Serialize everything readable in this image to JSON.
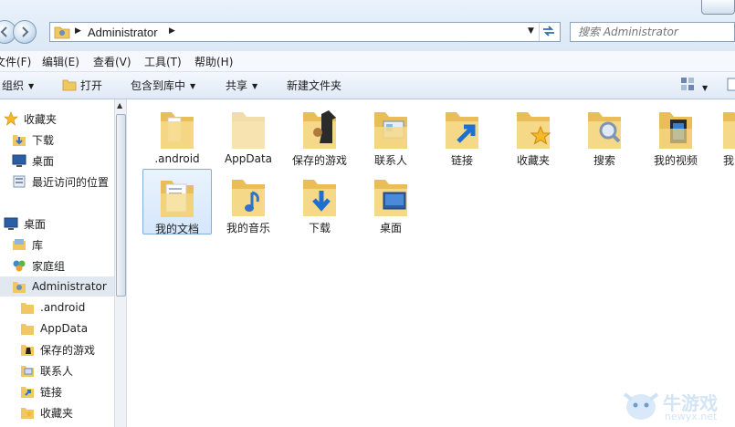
{
  "address": {
    "path": "Administrator"
  },
  "search": {
    "placeholder": "搜索 Administrator"
  },
  "menu": [
    "文件(F)",
    "编辑(E)",
    "查看(V)",
    "工具(T)",
    "帮助(H)"
  ],
  "toolbar": {
    "organize": "组织",
    "open": "打开",
    "include": "包含到库中",
    "share": "共享",
    "new_folder": "新建文件夹"
  },
  "nav": {
    "favorites": "收藏夹",
    "downloads": "下载",
    "desktop_fav": "桌面",
    "recent": "最近访问的位置",
    "desktop": "桌面",
    "libraries": "库",
    "homegroup": "家庭组",
    "admin": "Administrator",
    "android": ".android",
    "appdata": "AppData",
    "saved_games": "保存的游戏",
    "contacts": "联系人",
    "links": "链接",
    "fav_sub": "收藏夹"
  },
  "items": [
    ".android",
    "AppData",
    "保存的游戏",
    "联系人",
    "链接",
    "收藏夹",
    "搜索",
    "我的视频",
    "我",
    "我的文档",
    "我的音乐",
    "下载",
    "桌面"
  ],
  "watermark": {
    "cn": "牛游戏",
    "url": "newyx.net"
  },
  "colors": {
    "folder": "#f3d27a",
    "selection": "#d5e7fb",
    "accent": "#3b78d8"
  }
}
